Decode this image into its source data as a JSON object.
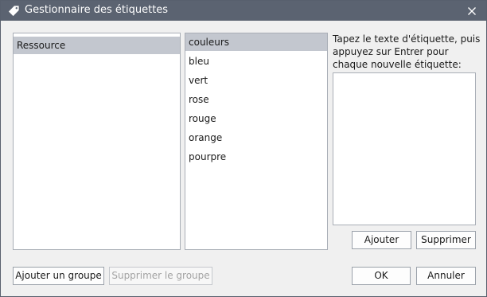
{
  "window": {
    "title": "Gestionnaire des étiquettes",
    "icon": "tag-icon",
    "close_icon": "close-icon"
  },
  "left_list": {
    "items": [
      {
        "label": "Ressource",
        "selected": true
      }
    ]
  },
  "tag_list": {
    "items": [
      {
        "label": "couleurs",
        "selected": true
      },
      {
        "label": "bleu",
        "selected": false
      },
      {
        "label": "vert",
        "selected": false
      },
      {
        "label": "rose",
        "selected": false
      },
      {
        "label": "rouge",
        "selected": false
      },
      {
        "label": "orange",
        "selected": false
      },
      {
        "label": "pourpre",
        "selected": false
      }
    ]
  },
  "entry": {
    "instruction": "Tapez le texte d'étiquette, puis appuyez sur Entrer pour chaque nouvelle étiquette:",
    "value": ""
  },
  "buttons": {
    "add": "Ajouter",
    "delete": "Supprimer",
    "add_group": "Ajouter un groupe",
    "delete_group": "Supprimer le groupe",
    "ok": "OK",
    "cancel": "Annuler"
  },
  "colors": {
    "titlebar": "#5b6371",
    "selection": "#c3c7cf",
    "background": "#f0f0f0"
  }
}
